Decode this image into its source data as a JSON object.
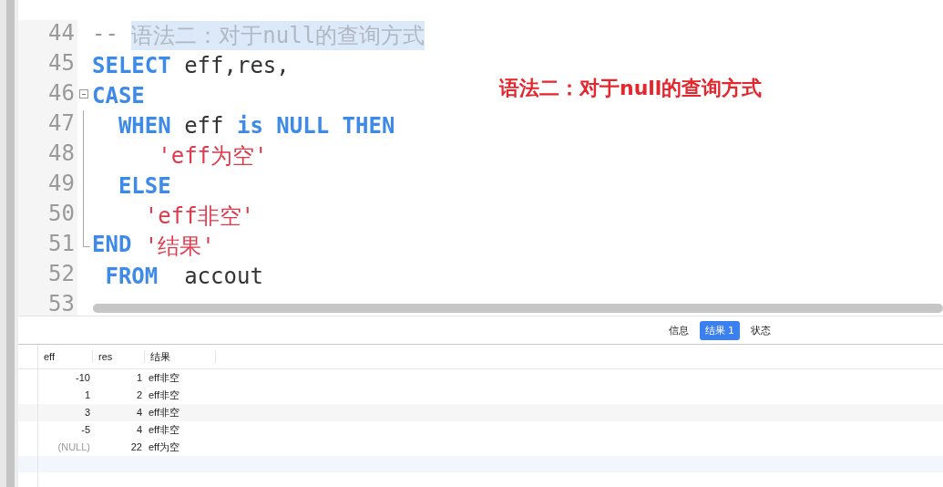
{
  "editor": {
    "lines": [
      {
        "number": "44",
        "kind": "plain",
        "tokens": [
          {
            "kind": "comment",
            "text": "-- "
          },
          {
            "kind": "selection",
            "text": "语法二：对于null的查询方式"
          }
        ]
      },
      {
        "number": "45",
        "kind": "plain",
        "tokens": [
          {
            "kind": "keyword",
            "text": "SELECT"
          },
          {
            "kind": "plain",
            "text": " eff,res,"
          }
        ]
      },
      {
        "number": "46",
        "kind": "fold-start",
        "tokens": [
          {
            "kind": "keyword",
            "text": "CASE"
          }
        ]
      },
      {
        "number": "47",
        "kind": "fold-inside",
        "tokens": [
          {
            "kind": "keyword",
            "text": "  WHEN"
          },
          {
            "kind": "plain",
            "text": " eff "
          },
          {
            "kind": "keyword",
            "text": "is NULL THEN"
          }
        ]
      },
      {
        "number": "48",
        "kind": "fold-inside",
        "tokens": [
          {
            "kind": "string",
            "text": "     'eff为空'"
          }
        ]
      },
      {
        "number": "49",
        "kind": "fold-inside",
        "tokens": [
          {
            "kind": "keyword",
            "text": "  ELSE"
          }
        ]
      },
      {
        "number": "50",
        "kind": "fold-inside",
        "tokens": [
          {
            "kind": "string",
            "text": "    'eff非空'"
          }
        ]
      },
      {
        "number": "51",
        "kind": "fold-end",
        "tokens": [
          {
            "kind": "keyword",
            "text": "END"
          },
          {
            "kind": "string",
            "text": " '结果'"
          }
        ]
      },
      {
        "number": "52",
        "kind": "plain",
        "tokens": [
          {
            "kind": "keyword",
            "text": " FROM"
          },
          {
            "kind": "plain",
            "text": "  accout"
          }
        ]
      },
      {
        "number": "53",
        "kind": "plain"
      }
    ],
    "annotation": "语法二：对于null的查询方式"
  },
  "result_tabs": [
    {
      "label": "信息",
      "selected": false
    },
    {
      "label": "结果 1",
      "selected": true
    },
    {
      "label": "状态",
      "selected": false
    }
  ],
  "table": {
    "columns": [
      "eff",
      "res",
      "结果"
    ],
    "rows": [
      {
        "cells": [
          {
            "text": "-10",
            "null": false
          },
          {
            "text": "1",
            "null": false
          },
          {
            "text": "eff非空",
            "null": false
          }
        ]
      },
      {
        "cells": [
          {
            "text": "1",
            "null": false
          },
          {
            "text": "2",
            "null": false
          },
          {
            "text": "eff非空",
            "null": false
          }
        ]
      },
      {
        "cells": [
          {
            "text": "3",
            "null": false
          },
          {
            "text": "4",
            "null": false
          },
          {
            "text": "eff非空",
            "null": false
          }
        ]
      },
      {
        "cells": [
          {
            "text": "-5",
            "null": false
          },
          {
            "text": "4",
            "null": false
          },
          {
            "text": "eff非空",
            "null": false
          }
        ]
      },
      {
        "cells": [
          {
            "text": "(NULL)",
            "null": true
          },
          {
            "text": "22",
            "null": false
          },
          {
            "text": "eff为空",
            "null": false
          }
        ]
      }
    ]
  }
}
